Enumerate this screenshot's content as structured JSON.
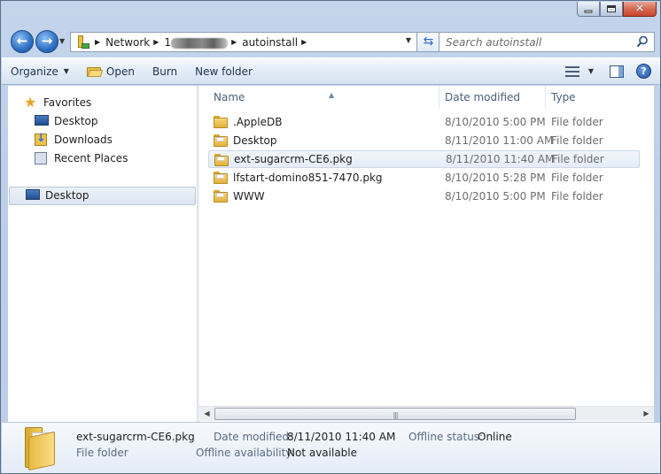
{
  "window": {
    "minimize_glyph": "",
    "close_glyph": "✕"
  },
  "nav": {
    "back_glyph": "←",
    "forward_glyph": "→"
  },
  "address": {
    "segments": [
      "Network",
      "1",
      "autoinstall"
    ],
    "separator_glyph": "▶"
  },
  "search": {
    "placeholder": "Search autoinstall"
  },
  "toolbar": {
    "organize": "Organize",
    "open": "Open",
    "burn": "Burn",
    "new_folder": "New folder",
    "help": "?"
  },
  "navpane": {
    "favorites": "Favorites",
    "items": [
      "Desktop",
      "Downloads",
      "Recent Places"
    ],
    "root": "Desktop"
  },
  "columns": {
    "name": "Name",
    "date": "Date modified",
    "type": "Type"
  },
  "files": [
    {
      "name": ".AppleDB",
      "date": "8/10/2010 5:00 PM",
      "type": "File folder"
    },
    {
      "name": "Desktop",
      "date": "8/11/2010 11:00 AM",
      "type": "File folder"
    },
    {
      "name": "ext-sugarcrm-CE6.pkg",
      "date": "8/11/2010 11:40 AM",
      "type": "File folder"
    },
    {
      "name": "lfstart-domino851-7470.pkg",
      "date": "8/10/2010 5:28 PM",
      "type": "File folder"
    },
    {
      "name": "WWW",
      "date": "8/10/2010 5:00 PM",
      "type": "File folder"
    }
  ],
  "selected_index": 2,
  "details": {
    "name": "ext-sugarcrm-CE6.pkg",
    "type": "File folder",
    "date_label": "Date modified:",
    "date_value": "8/11/2010 11:40 AM",
    "offline_status_label": "Offline status:",
    "offline_status_value": "Online",
    "offline_avail_label": "Offline availability:",
    "offline_avail_value": "Not available"
  },
  "colors": {
    "chrome": "#c4d5ea",
    "accent": "#2e6fc4",
    "selection": "#e4ecf6"
  }
}
